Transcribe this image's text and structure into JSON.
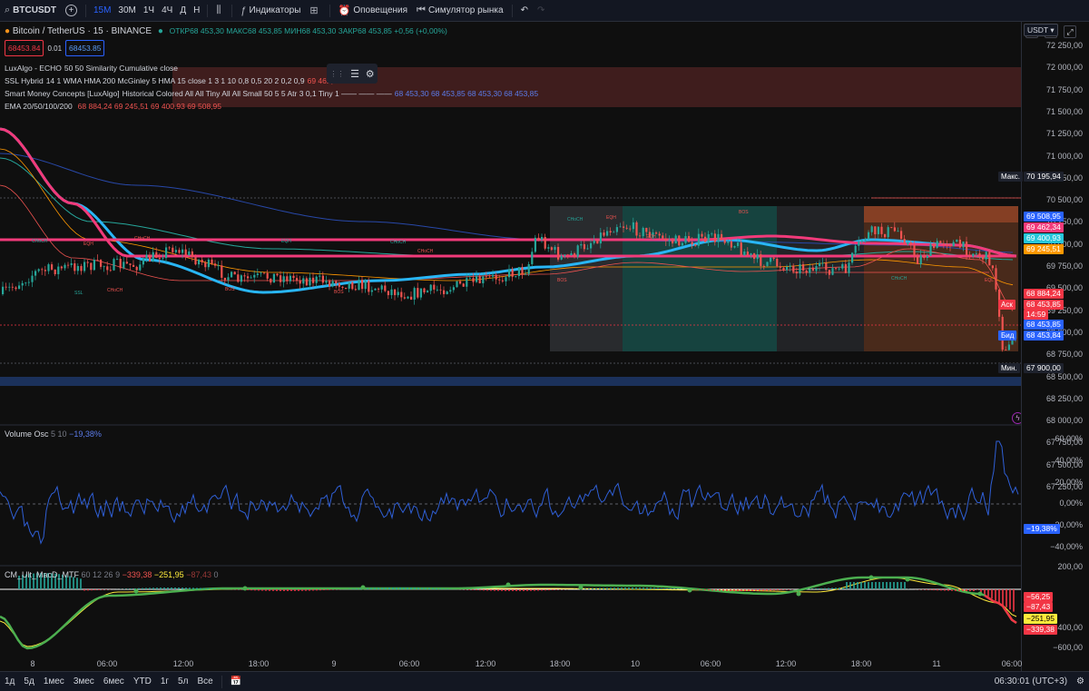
{
  "toolbar": {
    "symbol": "BTCUSDT",
    "intervals": [
      "15М",
      "30М",
      "1Ч",
      "4Ч",
      "Д",
      "Н"
    ],
    "active_interval": "15М",
    "indicators_label": "Индикаторы",
    "alerts_label": "Оповещения",
    "replay_label": "Симулятор рынка"
  },
  "header": {
    "title": "Bitcoin / TetherUS · 15 · BINANCE",
    "ohlc": "ОТКР68 453,30 МАКС68 453,85 МИН68 453,30 ЗАКР68 453,85 +0,56 (+0,00%)",
    "sell_price": "68453.84",
    "spread": "0.01",
    "buy_price": "68453.85",
    "currency": "USDT"
  },
  "legends": [
    {
      "name": "LuxAlgo - ECHO",
      "params": "50 50 Similarity Cumulative close",
      "values": ""
    },
    {
      "name": "SSL Hybrid",
      "params": "14 1 WMA HMA 200 McGinley 5 HMA 15 close 1 3 1 10 0,8 0,5 20 2 0,2 0,9",
      "values": "69 462,34"
    },
    {
      "name": "Smart Money Concepts [LuxAlgo]",
      "params": "Historical Colored All All Tiny All All Small 50 5 5 Atr 3 0,1 Tiny 1 —— —— ——",
      "values": "68 453,30  68 453,85  68 453,30  68 453,85"
    },
    {
      "name": "EMA 20/50/100/200",
      "params": "",
      "values": "68 884,24  69 245,51  69 400,93  69 508,95"
    }
  ],
  "price_axis": [
    "72 250,00",
    "72 000,00",
    "71 750,00",
    "71 500,00",
    "71 250,00",
    "71 000,00",
    "70 750,00",
    "70 500,00",
    "70 250,00",
    "70 000,00",
    "69 750,00",
    "69 500,00",
    "69 250,00",
    "69 000,00",
    "68 750,00",
    "68 500,00",
    "68 250,00",
    "68 000,00",
    "67 750,00",
    "67 500,00",
    "67 250,00"
  ],
  "price_tags": {
    "max_label": "Макс.",
    "max_value": "70 195,94",
    "ema200": "69 508,95",
    "ssl": "69 462,34",
    "ema100": "69 400,93",
    "ema50": "69 245,51",
    "ema20": "68 884,24",
    "ask_label": "Аск",
    "ask": "68 453,85",
    "countdown": "14:59",
    "bid_label": "Бид",
    "bid": "68 453,84",
    "last": "68 453,85",
    "min_label": "Мин.",
    "min_value": "67 900,00"
  },
  "smc_labels": [
    "CHoCH",
    "CHoCH",
    "EQH",
    "CHoCH",
    "BOS",
    "CHoCH",
    "EQH",
    "BOS",
    "CHoCH",
    "SSL",
    "BOS",
    "EQH",
    "CHoCH",
    "EQH",
    "BOS",
    "CHoCH",
    "EQL"
  ],
  "volume_osc": {
    "name": "Volume Osc",
    "params": "5 10",
    "value": "−19,38%",
    "axis": [
      "60,00%",
      "40,00%",
      "20,00%",
      "0,00%",
      "−20,00%",
      "−40,00%"
    ],
    "tag": "−19,38%"
  },
  "macd": {
    "name": "CM_Ult_MacD_MTF",
    "params": "60 12 26 9",
    "v1": "−339,38",
    "v2": "−251,95",
    "v3": "−87,43",
    "v4": "0",
    "axis": [
      "200,00",
      "−400,00",
      "−600,00"
    ],
    "tags": [
      "−56,25",
      "−87,43",
      "−251,95",
      "−339,38"
    ]
  },
  "time_axis": [
    "8",
    "06:00",
    "12:00",
    "18:00",
    "9",
    "06:00",
    "12:00",
    "18:00",
    "10",
    "06:00",
    "12:00",
    "18:00",
    "11",
    "06:00"
  ],
  "bottom": {
    "ranges": [
      "1д",
      "5д",
      "1мес",
      "3мес",
      "6мес",
      "YTD",
      "1г",
      "5л",
      "Все"
    ],
    "clock": "06:30:01 (UTC+3)"
  },
  "colors": {
    "up": "#26a69a",
    "down": "#ef5350",
    "ssl": "#f23a7a",
    "ema_cyan": "#29b6f6",
    "accent": "#2962ff"
  }
}
